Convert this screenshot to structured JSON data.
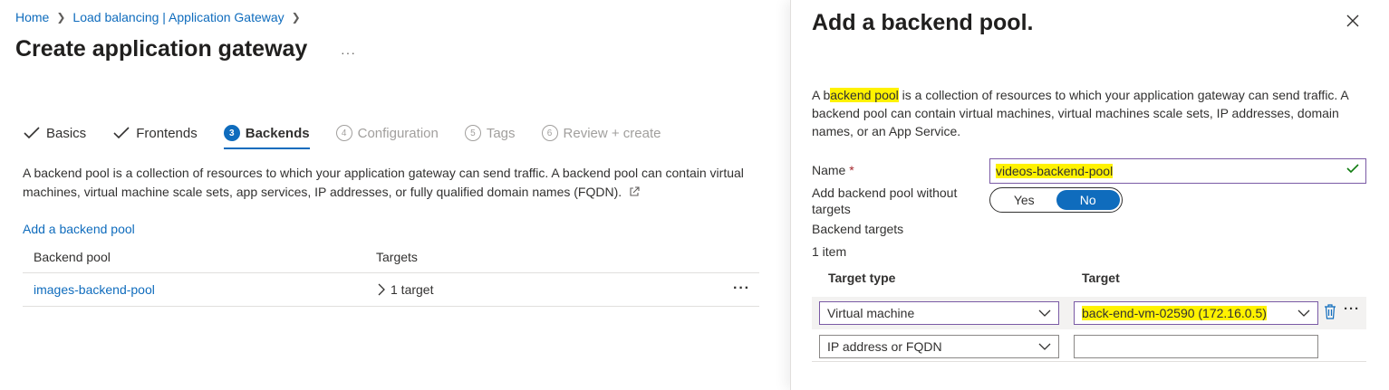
{
  "breadcrumb": {
    "items": [
      "Home",
      "Load balancing | Application Gateway"
    ]
  },
  "page": {
    "title": "Create application gateway",
    "more": "···"
  },
  "tabs": [
    {
      "label": "Basics",
      "state": "done"
    },
    {
      "label": "Frontends",
      "state": "done"
    },
    {
      "label": "Backends",
      "state": "active",
      "step": "3"
    },
    {
      "label": "Configuration",
      "state": "disabled",
      "step": "4"
    },
    {
      "label": "Tags",
      "state": "disabled",
      "step": "5"
    },
    {
      "label": "Review + create",
      "state": "disabled",
      "step": "6"
    }
  ],
  "backends": {
    "description": "A backend pool is a collection of resources to which your application gateway can send traffic. A backend pool can contain virtual machines, virtual machine scale sets, app services, IP addresses, or fully qualified domain names (FQDN).",
    "add_link": "Add a backend pool",
    "columns": [
      "Backend pool",
      "Targets"
    ],
    "rows": [
      {
        "pool": "images-backend-pool",
        "targets": "1 target"
      }
    ]
  },
  "panel": {
    "title": "Add a backend pool.",
    "desc_pre": "A b",
    "desc_hl": "ackend pool",
    "desc_post": " is a collection of resources to which your application gateway can send traffic. A backend pool can contain virtual machines, virtual machines scale sets, IP addresses, domain names, or an App Service.",
    "name_label": "Name",
    "required_mark": "*",
    "name_value": "videos-backend-pool",
    "without_targets_label": "Add backend pool without targets",
    "toggle_yes": "Yes",
    "toggle_no": "No",
    "toggle_selected": "No",
    "targets_label": "Backend targets",
    "item_count": "1 item",
    "target_type_header": "Target type",
    "target_header": "Target",
    "targets": [
      {
        "type": "Virtual machine",
        "target": "back-end-vm-02590 (172.16.0.5)"
      },
      {
        "type": "IP address or FQDN",
        "target": ""
      }
    ]
  },
  "colors": {
    "accent": "#0f6cbd",
    "highlight": "#fff200",
    "success": "#107c10",
    "focus_border": "#7a5aa5"
  }
}
